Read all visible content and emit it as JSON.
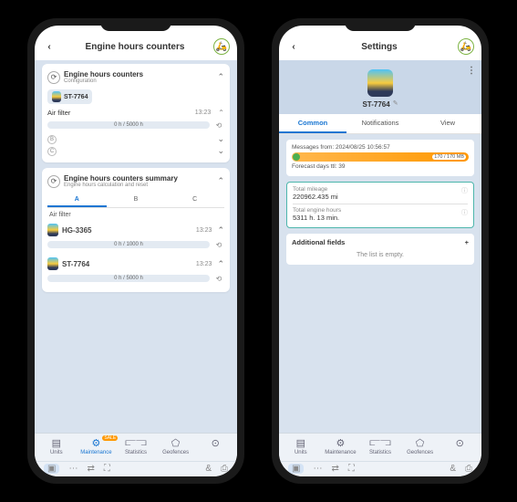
{
  "phone1": {
    "header": {
      "title": "Engine hours counters"
    },
    "card1": {
      "title": "Engine hours counters",
      "subtitle": "Configuration",
      "unit": "ST-7764",
      "item_label": "Air filter",
      "item_time": "13:23",
      "bar_text": "0 h / 5000 h",
      "b_label": "B",
      "c_label": "C"
    },
    "card2": {
      "title": "Engine hours counters summary",
      "subtitle": "Engine hours calculation and reset",
      "tabs": {
        "a": "A",
        "b": "B",
        "c": "C"
      },
      "section": "Air filter",
      "rows": [
        {
          "name": "HG-3365",
          "time": "13:23",
          "bar": "0 h / 1000 h"
        },
        {
          "name": "ST-7764",
          "time": "13:23",
          "bar": "0 h / 5000 h"
        }
      ]
    },
    "bottom_nav": {
      "units": "Units",
      "maintenance": "Maintenance",
      "statistics": "Statistics",
      "geofences": "Geofences",
      "sale": "SALE"
    }
  },
  "phone2": {
    "header": {
      "title": "Settings"
    },
    "unit": "ST-7764",
    "tabs": {
      "common": "Common",
      "notifications": "Notifications",
      "view": "View"
    },
    "messages": {
      "label": "Messages from: 2024/08/25 10:56:57",
      "bar_value": "170 / 170 MB",
      "forecast": "Forecast days ttl: 39"
    },
    "metrics": {
      "mileage_label": "Total mileage",
      "mileage_value": "220962.435 mi",
      "hours_label": "Total engine hours",
      "hours_value": "5311 h. 13 min."
    },
    "additional": {
      "title": "Additional fields",
      "empty": "The list is empty."
    },
    "bottom_nav": {
      "units": "Units",
      "maintenance": "Maintenance",
      "statistics": "Statistics",
      "geofences": "Geofences"
    }
  }
}
